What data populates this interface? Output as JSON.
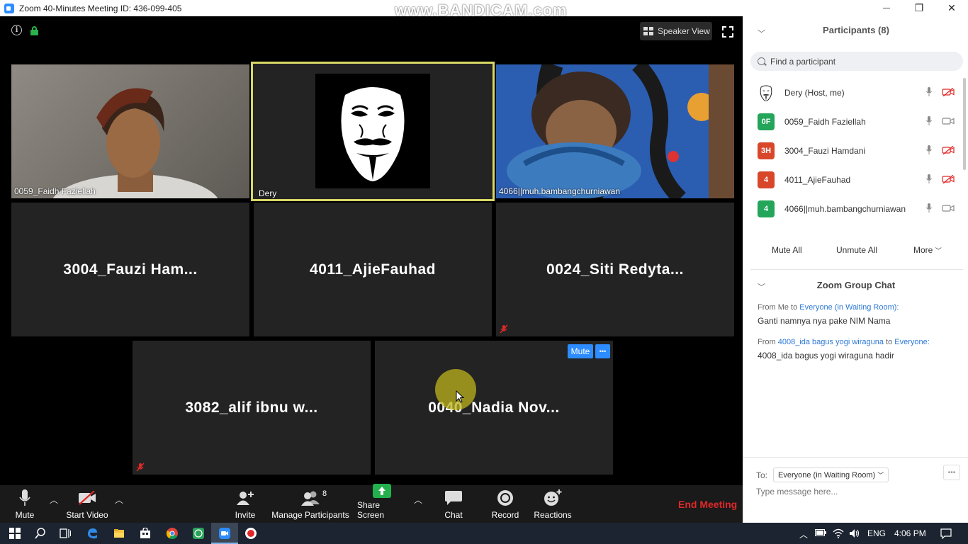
{
  "window": {
    "title": "Zoom 40-Minutes Meeting ID: 436-099-405",
    "watermark": "www.BANDICAM.com",
    "controls": {
      "minimize": "—",
      "maximize": "❐",
      "close": "✕"
    }
  },
  "meeting": {
    "speaker_view_label": "Speaker View",
    "tiles": [
      {
        "name": "0059_Faidh Faziellah",
        "type": "video"
      },
      {
        "name": "Dery",
        "type": "video",
        "active_speaker": true
      },
      {
        "name": "4066||muh.bambangchurniawan",
        "type": "video"
      },
      {
        "name": "3004_Fauzi Ham...",
        "type": "name"
      },
      {
        "name": "4011_AjieFauhad",
        "type": "name"
      },
      {
        "name": "0024_Siti  Redyta...",
        "type": "name",
        "muted": true
      },
      {
        "name": "3082_alif ibnu w...",
        "type": "name",
        "muted": true
      },
      {
        "name": "0040_Nadia  Nov...",
        "type": "name",
        "hover_mute_label": "Mute",
        "hover_more_label": "•••"
      }
    ]
  },
  "toolbar": {
    "mute": "Mute",
    "start_video": "Start Video",
    "invite": "Invite",
    "manage_participants": "Manage Participants",
    "participant_count": "8",
    "share_screen": "Share Screen",
    "chat": "Chat",
    "record": "Record",
    "reactions": "Reactions",
    "end_meeting": "End Meeting"
  },
  "participants_panel": {
    "title": "Participants (8)",
    "search_placeholder": "Find a participant",
    "participants": [
      {
        "name": "Dery (Host, me)",
        "avatar_text": "",
        "avatar_color": "#ffffff",
        "video_off": true
      },
      {
        "name": "0059_Faidh Faziellah",
        "avatar_text": "0F",
        "avatar_color": "#23a55a",
        "video_off": false
      },
      {
        "name": "3004_Fauzi Hamdani",
        "avatar_text": "3H",
        "avatar_color": "#d9472b",
        "video_off": true
      },
      {
        "name": "4011_AjieFauhad",
        "avatar_text": "4",
        "avatar_color": "#d9472b",
        "video_off": true
      },
      {
        "name": "4066||muh.bambangchurniawan",
        "avatar_text": "4",
        "avatar_color": "#23a55a",
        "video_off": false
      },
      {
        "name": "",
        "avatar_text": "",
        "avatar_color": "#f0a020",
        "video_off": false
      }
    ],
    "mute_all": "Mute All",
    "unmute_all": "Unmute All",
    "more": "More"
  },
  "chat_panel": {
    "title": "Zoom Group Chat",
    "messages": [
      {
        "from_prefix": "From Me to ",
        "from_name": "",
        "to_prefix": "",
        "to": "Everyone (in Waiting Room):",
        "text": "Ganti namnya nya pake NIM Nama"
      },
      {
        "from_prefix": "From ",
        "from_name": "4008_ida bagus yogi wiraguna",
        "to_prefix": " to ",
        "to": "Everyone:",
        "text": "4008_ida bagus yogi wiraguna hadir"
      }
    ],
    "to_label": "To:",
    "recipient": "Everyone (in Waiting Room)",
    "input_placeholder": "Type message here..."
  },
  "taskbar": {
    "language": "ENG",
    "time": "4:06 PM"
  },
  "colors": {
    "accent_blue": "#2d8cff",
    "end_meeting_red": "#e02828",
    "active_speaker_outline": "#d8d866",
    "muted_red": "#e02828"
  }
}
